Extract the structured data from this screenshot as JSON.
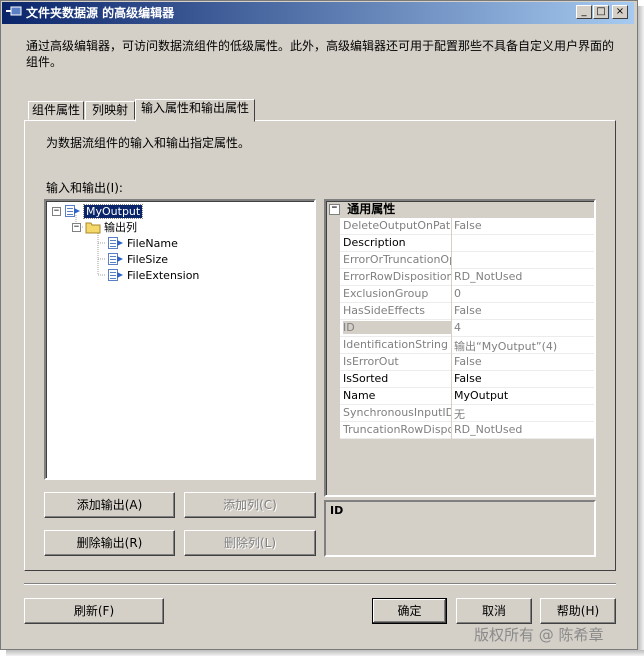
{
  "window": {
    "title": "文件夹数据源 的高级编辑器",
    "description": "通过高级编辑器，可访问数据流组件的低级属性。此外，高级编辑器还可用于配置那些不具备自定义用户界面的组件。",
    "caption_buttons": {
      "minimize": "_",
      "maximize": "□",
      "close": "×"
    }
  },
  "tabs": [
    {
      "label": "组件属性",
      "active": false
    },
    {
      "label": "列映射",
      "active": false
    },
    {
      "label": "输入属性和输出属性",
      "active": true
    }
  ],
  "panel": {
    "description": "为数据流组件的输入和输出指定属性。",
    "io_label": "输入和输出(I):"
  },
  "tree": {
    "root": {
      "label": "MyOutput",
      "expander": "−",
      "selected": true
    },
    "folder": {
      "label": "输出列",
      "expander": "−"
    },
    "columns": [
      "FileName",
      "FileSize",
      "FileExtension"
    ]
  },
  "buttons": {
    "add_output": "添加输出(A)",
    "add_column": "添加列(C)",
    "remove_output": "删除输出(R)",
    "remove_column": "删除列(L)",
    "refresh": "刷新(F)",
    "ok": "确定",
    "cancel": "取消",
    "help": "帮助(H)"
  },
  "properties": {
    "category": "通用属性",
    "category_expander": "−",
    "rows": [
      {
        "name": "DeleteOutputOnPathDetached",
        "value": "False",
        "enabled": false
      },
      {
        "name": "Description",
        "value": "",
        "enabled": true
      },
      {
        "name": "ErrorOrTruncationOperation",
        "value": "",
        "enabled": false
      },
      {
        "name": "ErrorRowDisposition",
        "value": "RD_NotUsed",
        "enabled": false
      },
      {
        "name": "ExclusionGroup",
        "value": "0",
        "enabled": false
      },
      {
        "name": "HasSideEffects",
        "value": "False",
        "enabled": false
      },
      {
        "name": "ID",
        "value": "4",
        "enabled": false,
        "selected": true
      },
      {
        "name": "IdentificationString",
        "value": "输出“MyOutput”(4)",
        "enabled": false
      },
      {
        "name": "IsErrorOut",
        "value": "False",
        "enabled": false
      },
      {
        "name": "IsSorted",
        "value": "False",
        "enabled": true
      },
      {
        "name": "Name",
        "value": "MyOutput",
        "enabled": true
      },
      {
        "name": "SynchronousInputID",
        "value": "无",
        "enabled": false
      },
      {
        "name": "TruncationRowDisposition",
        "value": "RD_NotUsed",
        "enabled": false
      }
    ]
  },
  "help_panel": {
    "title": "ID"
  },
  "watermark": "版权所有 @ 陈希章",
  "colors": {
    "titlebar_start": "#0a246a",
    "titlebar_end": "#a6caf0",
    "face": "#d4d0c8",
    "selection": "#0a246a"
  }
}
